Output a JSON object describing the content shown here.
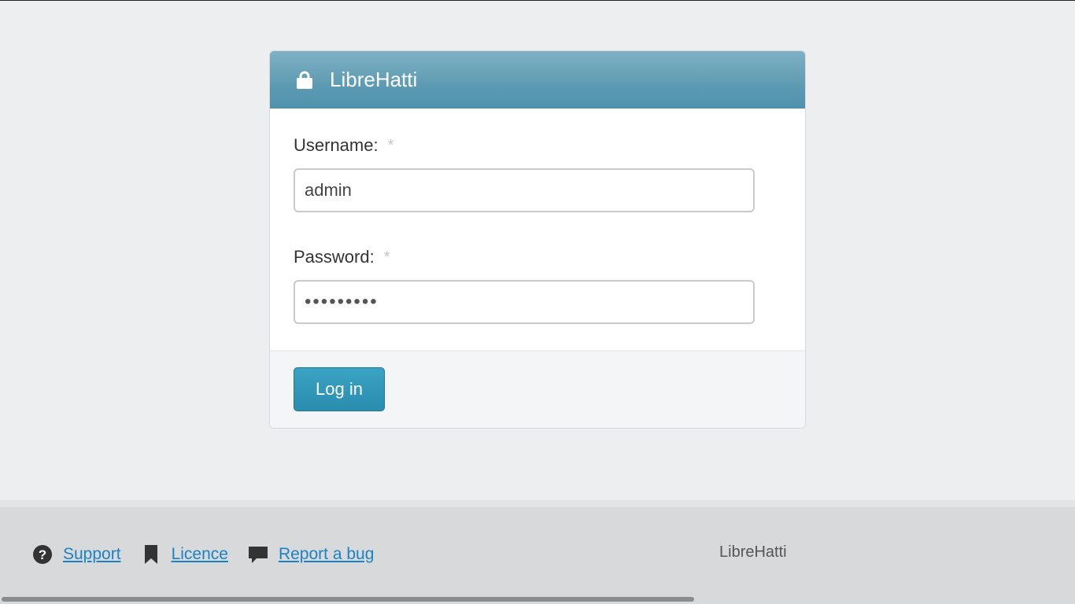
{
  "app": {
    "title": "LibreHatti"
  },
  "login": {
    "header_title": "LibreHatti",
    "username_label": "Username:",
    "username_required": "*",
    "username_value": "admin",
    "password_label": "Password:",
    "password_required": "*",
    "password_value": "•••••••••",
    "submit_label": "Log in"
  },
  "footer": {
    "links": [
      {
        "label": "Support",
        "icon": "question-circle-icon"
      },
      {
        "label": "Licence",
        "icon": "bookmark-icon"
      },
      {
        "label": "Report a bug",
        "icon": "comment-icon"
      }
    ],
    "brand": "LibreHatti"
  },
  "colors": {
    "header": "#5d9bb3",
    "button": "#2b8db0",
    "link": "#1b82c4"
  }
}
